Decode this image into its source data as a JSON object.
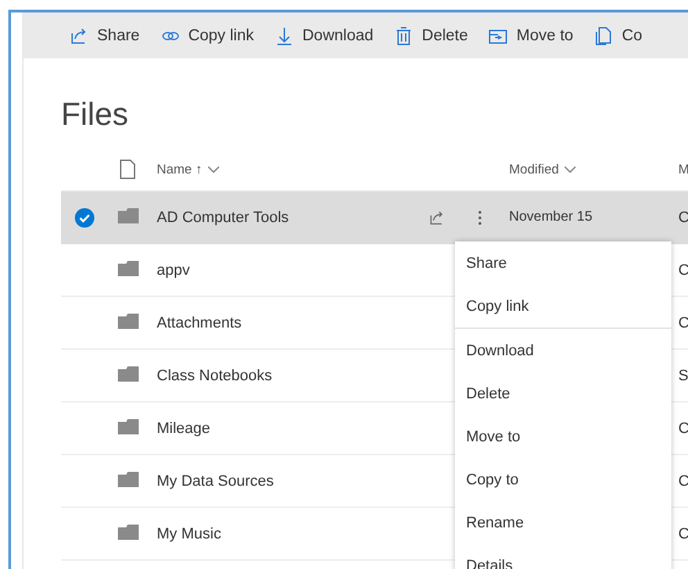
{
  "toolbar": [
    {
      "kind": "share",
      "label": "Share"
    },
    {
      "kind": "link",
      "label": "Copy link"
    },
    {
      "kind": "download",
      "label": "Download"
    },
    {
      "kind": "delete",
      "label": "Delete"
    },
    {
      "kind": "move",
      "label": "Move to"
    },
    {
      "kind": "copy",
      "label": "Co"
    }
  ],
  "title": "Files",
  "table": {
    "columns": [
      "Name ↑",
      "Modified",
      "M"
    ],
    "rows": [
      {
        "name": "AD Computer Tools",
        "modified": "November 15",
        "column_3": "C",
        "selected": true
      },
      {
        "name": "appv",
        "column_3": "C",
        "selected": false
      },
      {
        "name": "Attachments",
        "column_3": "C",
        "selected": false
      },
      {
        "name": "Class Notebooks",
        "column_3": "S",
        "selected": false
      },
      {
        "name": "Mileage",
        "column_3": "C",
        "selected": false
      },
      {
        "name": "My Data Sources",
        "column_3": "C",
        "selected": false
      },
      {
        "name": "My Music",
        "column_3": "C",
        "selected": false
      }
    ]
  },
  "context_menu": {
    "groups": [
      [
        "Share",
        "Copy link"
      ],
      [
        "Download",
        "Delete",
        "Move to",
        "Copy to",
        "Rename",
        "Details"
      ]
    ]
  }
}
